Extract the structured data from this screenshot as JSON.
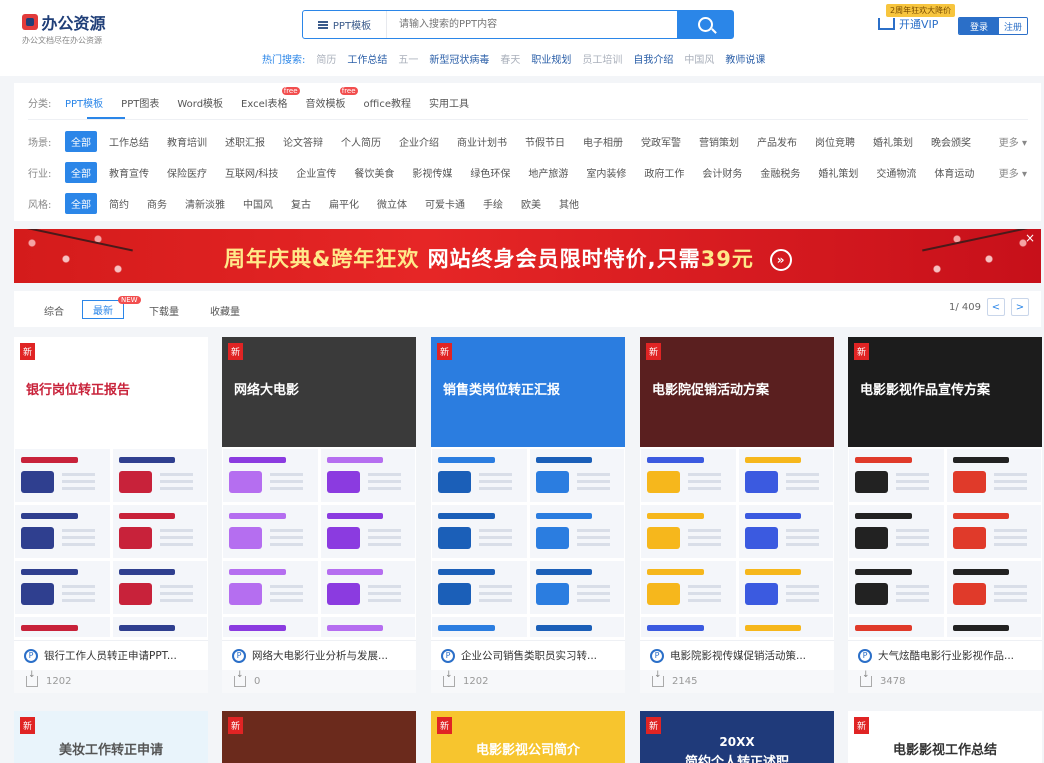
{
  "header": {
    "logo": "办公资源",
    "slogan": "办公文档尽在办公资源",
    "search_category": "PPT模板",
    "search_placeholder": "请输入搜索的PPT内容",
    "hot_label": "热门搜索:",
    "hot_links": [
      {
        "text": "简历",
        "grey": true
      },
      {
        "text": "工作总结",
        "grey": false
      },
      {
        "text": "五一",
        "grey": true
      },
      {
        "text": "新型冠状病毒",
        "grey": false
      },
      {
        "text": "春天",
        "grey": true
      },
      {
        "text": "职业规划",
        "grey": false
      },
      {
        "text": "员工培训",
        "grey": true
      },
      {
        "text": "自我介绍",
        "grey": false
      },
      {
        "text": "中国风",
        "grey": true
      },
      {
        "text": "教师说课",
        "grey": false
      }
    ],
    "vip_tag": "2周年狂欢大降价",
    "vip_label": "开通VIP",
    "login": "登录",
    "register": "注册"
  },
  "filters": {
    "category_label": "分类:",
    "categories": [
      {
        "text": "PPT模板",
        "free": false
      },
      {
        "text": "PPT图表",
        "free": false
      },
      {
        "text": "Word模板",
        "free": false
      },
      {
        "text": "Excel表格",
        "free": true
      },
      {
        "text": "音效模板",
        "free": true
      },
      {
        "text": "office教程",
        "free": false
      },
      {
        "text": "实用工具",
        "free": false
      }
    ],
    "free_tag": "free",
    "scene_label": "场景:",
    "scenes": [
      "全部",
      "工作总结",
      "教育培训",
      "述职汇报",
      "论文答辩",
      "个人简历",
      "企业介绍",
      "商业计划书",
      "节假节日",
      "电子相册",
      "党政军警",
      "营销策划",
      "产品发布",
      "岗位竞聘",
      "婚礼策划",
      "晚会颁奖"
    ],
    "industry_label": "行业:",
    "industries": [
      "全部",
      "教育宣传",
      "保险医疗",
      "互联网/科技",
      "企业宣传",
      "餐饮美食",
      "影视传媒",
      "绿色环保",
      "地产旅游",
      "室内装修",
      "政府工作",
      "会计财务",
      "金融税务",
      "婚礼策划",
      "交通物流",
      "体育运动"
    ],
    "style_label": "风格:",
    "styles": [
      "全部",
      "简约",
      "商务",
      "清新淡雅",
      "中国风",
      "复古",
      "扁平化",
      "微立体",
      "可爱卡通",
      "手绘",
      "欧美",
      "其他"
    ],
    "more": "更多"
  },
  "banner": {
    "text_yellow": "周年庆典&跨年狂欢",
    "text_white": "网站终身会员限时特价,只需",
    "price": "39元",
    "go": "»",
    "close": "×"
  },
  "sort": {
    "items": [
      "综合",
      "最新",
      "下载量",
      "收藏量"
    ],
    "new_tag": "NEW",
    "page": "1/ 409",
    "prev": "<",
    "next": ">"
  },
  "cards": [
    {
      "badge": "新",
      "cover_title": "银行岗位转正报告",
      "title": "银行工作人员转正申请PPT...",
      "downloads": "1202",
      "accent": "#c8223a",
      "accent2": "#2f3f8f",
      "cover_bg": "#ffffff",
      "cover_color": "#c8223a"
    },
    {
      "badge": "新",
      "cover_title": "网络大电影",
      "title": "网络大电影行业分析与发展...",
      "downloads": "0",
      "accent": "#8b3be0",
      "accent2": "#b56ef0",
      "cover_bg": "#3a3a3a",
      "cover_color": "#ffffff"
    },
    {
      "badge": "新",
      "cover_title": "销售类岗位转正汇报",
      "title": "企业公司销售类职员实习转...",
      "downloads": "1202",
      "accent": "#2b7de0",
      "accent2": "#1b5fb8",
      "cover_bg": "#2b7de0",
      "cover_color": "#ffffff"
    },
    {
      "badge": "新",
      "cover_title": "电影院促销活动方案",
      "title": "电影院影视传媒促销活动策...",
      "downloads": "2145",
      "accent": "#3b5ae0",
      "accent2": "#f6b71c",
      "cover_bg": "#5a1f1f",
      "cover_color": "#ffffff"
    },
    {
      "badge": "新",
      "cover_title": "电影影视作品宣传方案",
      "title": "大气炫酷电影行业影视作品...",
      "downloads": "3478",
      "accent": "#e03a2a",
      "accent2": "#222222",
      "cover_bg": "#1c1c1c",
      "cover_color": "#ffffff"
    }
  ],
  "cards_row2": [
    {
      "badge": "新",
      "text": "美妆工作转正申请",
      "color": "#555555"
    },
    {
      "badge": "新",
      "text": "",
      "color": "#333333"
    },
    {
      "badge": "新",
      "text": "电影影视公司简介",
      "color": "#ffffff"
    },
    {
      "badge": "新",
      "text": "简约个人转正述职",
      "color": "#ffffff"
    },
    {
      "badge": "新",
      "text": "电影影视工作总结",
      "color": "#333333"
    }
  ],
  "row2_card4_year": "20XX"
}
